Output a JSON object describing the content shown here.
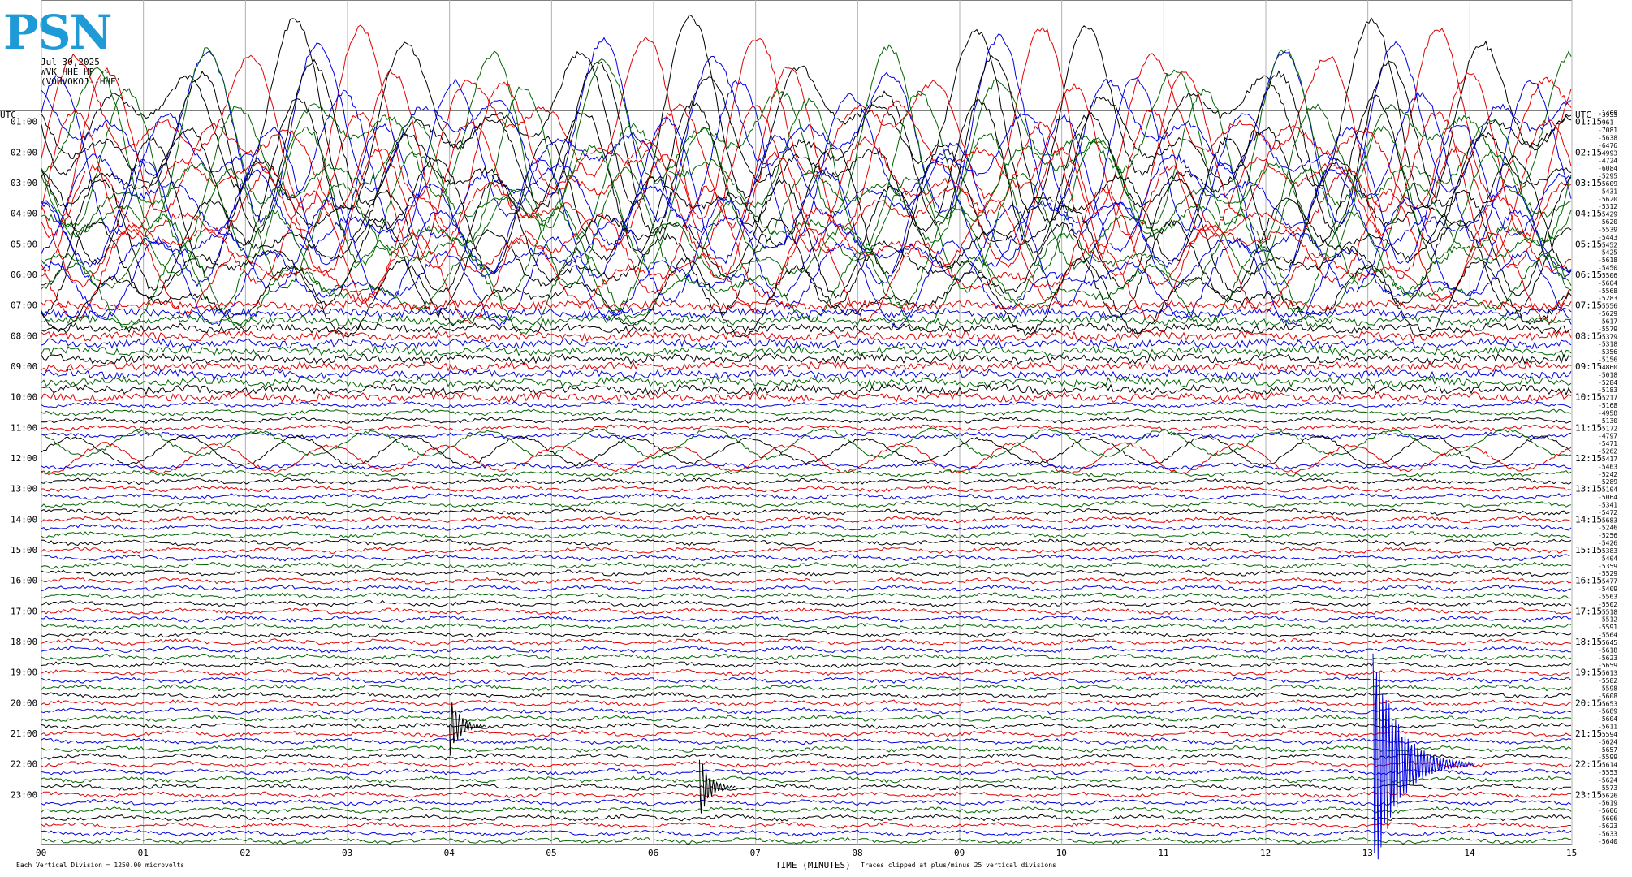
{
  "header": {
    "logo_text": "PSN",
    "date": "Jul 30,2025",
    "station": "WVK HHE HP --",
    "location": "(VOHVOKOJ--HHE)"
  },
  "axes": {
    "left_title": "UTC",
    "right_title": "UTC",
    "top_right_value": "-1460",
    "xlabel": "TIME (MINUTES)",
    "clip_note": "Traces clipped at plus/minus 25 vertical divisions",
    "scale_note": "Each Vertical Division = 1250.00 microvolts"
  },
  "colors": {
    "black": "#000000",
    "red": "#e00000",
    "blue": "#0000e0",
    "green": "#006400",
    "grid": "#b0b0b0"
  },
  "chart_data": {
    "type": "line",
    "title": "",
    "xlabel": "TIME (MINUTES)",
    "ylabel": "UTC",
    "xlim": [
      0,
      15
    ],
    "x_ticks": [
      "00",
      "01",
      "02",
      "03",
      "04",
      "05",
      "06",
      "07",
      "08",
      "09",
      "10",
      "11",
      "12",
      "13",
      "14",
      "15"
    ],
    "left_hour_labels": [
      "01:00",
      "02:00",
      "03:00",
      "04:00",
      "05:00",
      "06:00",
      "07:00",
      "08:00",
      "09:00",
      "10:00",
      "11:00",
      "12:00",
      "13:00",
      "14:00",
      "15:00",
      "16:00",
      "17:00",
      "18:00",
      "19:00",
      "20:00",
      "21:00",
      "22:00",
      "23:00"
    ],
    "right_hour_labels": [
      "01:15",
      "02:15",
      "03:15",
      "04:15",
      "05:15",
      "06:15",
      "07:15",
      "08:15",
      "09:15",
      "10:15",
      "11:15",
      "12:15",
      "13:15",
      "14:15",
      "15:15",
      "16:15",
      "17:15",
      "18:15",
      "19:15",
      "20:15",
      "21:15",
      "22:15",
      "23:15"
    ],
    "trace_color_cycle": [
      "black",
      "red",
      "blue",
      "green"
    ],
    "trace_count": 96,
    "trace_offsets": [
      "-3953",
      "-961",
      "-7081",
      "-5638",
      "-6476",
      "-4993",
      "-4724",
      "-6084",
      "-5295",
      "-5609",
      "-5431",
      "-5620",
      "-5312",
      "-5429",
      "-5620",
      "-5539",
      "-5443",
      "-5452",
      "-5425",
      "-5618",
      "-5450",
      "-5506",
      "-5604",
      "-5568",
      "-5283",
      "-5556",
      "-5629",
      "-5617",
      "-5579",
      "-5379",
      "-5318",
      "-5356",
      "-5156",
      "-4860",
      "-5018",
      "-5284",
      "-5183",
      "-5217",
      "-5168",
      "-4958",
      "-5130",
      "-5172",
      "-4797",
      "-5471",
      "-5262",
      "-5417",
      "-5463",
      "-5242",
      "-5289",
      "-5104",
      "-5064",
      "-5341",
      "-5472",
      "-5683",
      "-5246",
      "-5256",
      "-5426",
      "-5383",
      "-5404",
      "-5359",
      "-5529",
      "-5477",
      "-5409",
      "-5563",
      "-5502",
      "-5518",
      "-5512",
      "-5591",
      "-5564",
      "-5645",
      "-5618",
      "-5623",
      "-5659",
      "-5613",
      "-5582",
      "-5598",
      "-5608",
      "-5653",
      "-5689",
      "-5604",
      "-5611",
      "-5594",
      "-5624",
      "-5657",
      "-5599",
      "-5614",
      "-5553",
      "-5624",
      "-5573",
      "-5626",
      "-5619",
      "-5606",
      "-5606",
      "-5623",
      "-5633",
      "-5640"
    ],
    "activity_levels": {
      "clipped_until_hour": 6.25,
      "moderate_until_hour": 9.5,
      "long_period_band_hour": 11.0
    },
    "events": [
      {
        "hour_row": "20:00",
        "minute": 4.0,
        "color": "black",
        "label": ""
      },
      {
        "hour_row": "22:00",
        "minute": 6.45,
        "color": "black",
        "label": ""
      },
      {
        "hour_row": "21:15",
        "minute": 13.05,
        "color": "blue",
        "label": ""
      }
    ],
    "grid": true,
    "legend": "none"
  }
}
